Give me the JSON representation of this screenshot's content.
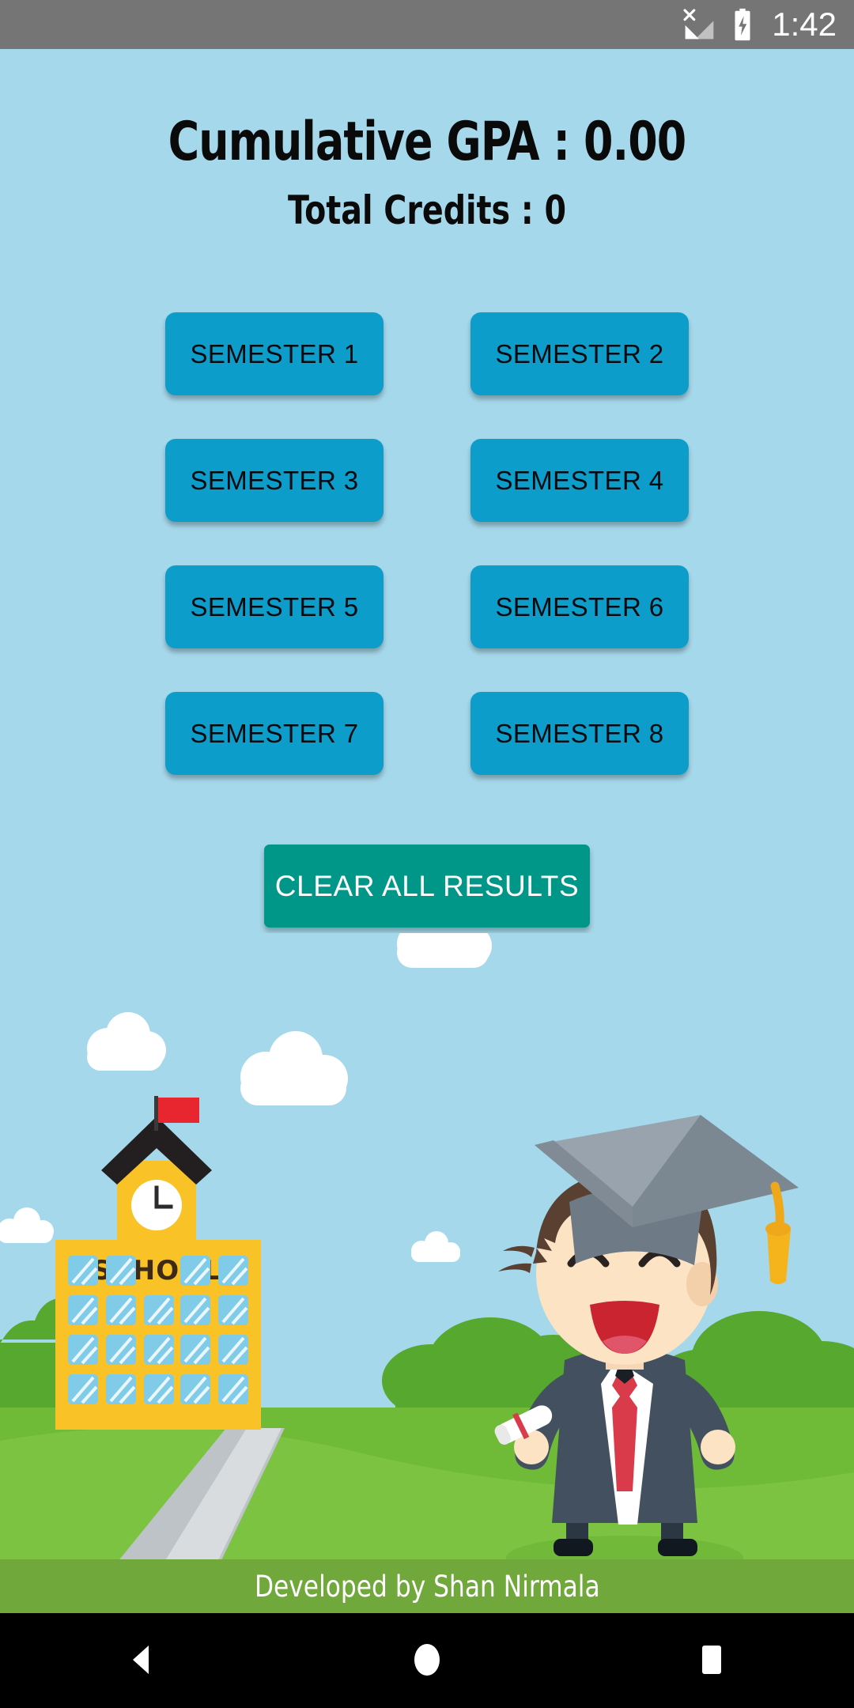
{
  "status_bar": {
    "time": "1:42",
    "icons": [
      "no-sim-signal-icon",
      "battery-charging-icon"
    ],
    "background_color": "#757575"
  },
  "header": {
    "gpa_label": "Cumulative GPA : 0.00",
    "credits_label": "Total Credits : 0",
    "gpa_value": "0.00",
    "total_credits": "0"
  },
  "semesters": {
    "buttons": [
      {
        "label": "SEMESTER 1"
      },
      {
        "label": "SEMESTER 2"
      },
      {
        "label": "SEMESTER 3"
      },
      {
        "label": "SEMESTER 4"
      },
      {
        "label": "SEMESTER 5"
      },
      {
        "label": "SEMESTER 6"
      },
      {
        "label": "SEMESTER 7"
      },
      {
        "label": "SEMESTER 8"
      }
    ],
    "button_color": "#0D9DCB",
    "text_color": "#050a0e"
  },
  "actions": {
    "clear_label": "CLEAR ALL RESULTS",
    "clear_color": "#009688"
  },
  "illustration": {
    "school_sign": "SCHOOL",
    "sky_color": "#A5D8EA",
    "grass_color": "#76BF3D",
    "bush_color": "#5BA830",
    "building_color": "#F9C327",
    "flag_color": "#E8262F",
    "path_color": "#BDC3C7"
  },
  "footer": {
    "credit_text": "Developed by Shan Nirmala",
    "background_color": "#71A83B"
  },
  "navigation": {
    "back_label": "Back",
    "home_label": "Home",
    "recents_label": "Recents"
  }
}
